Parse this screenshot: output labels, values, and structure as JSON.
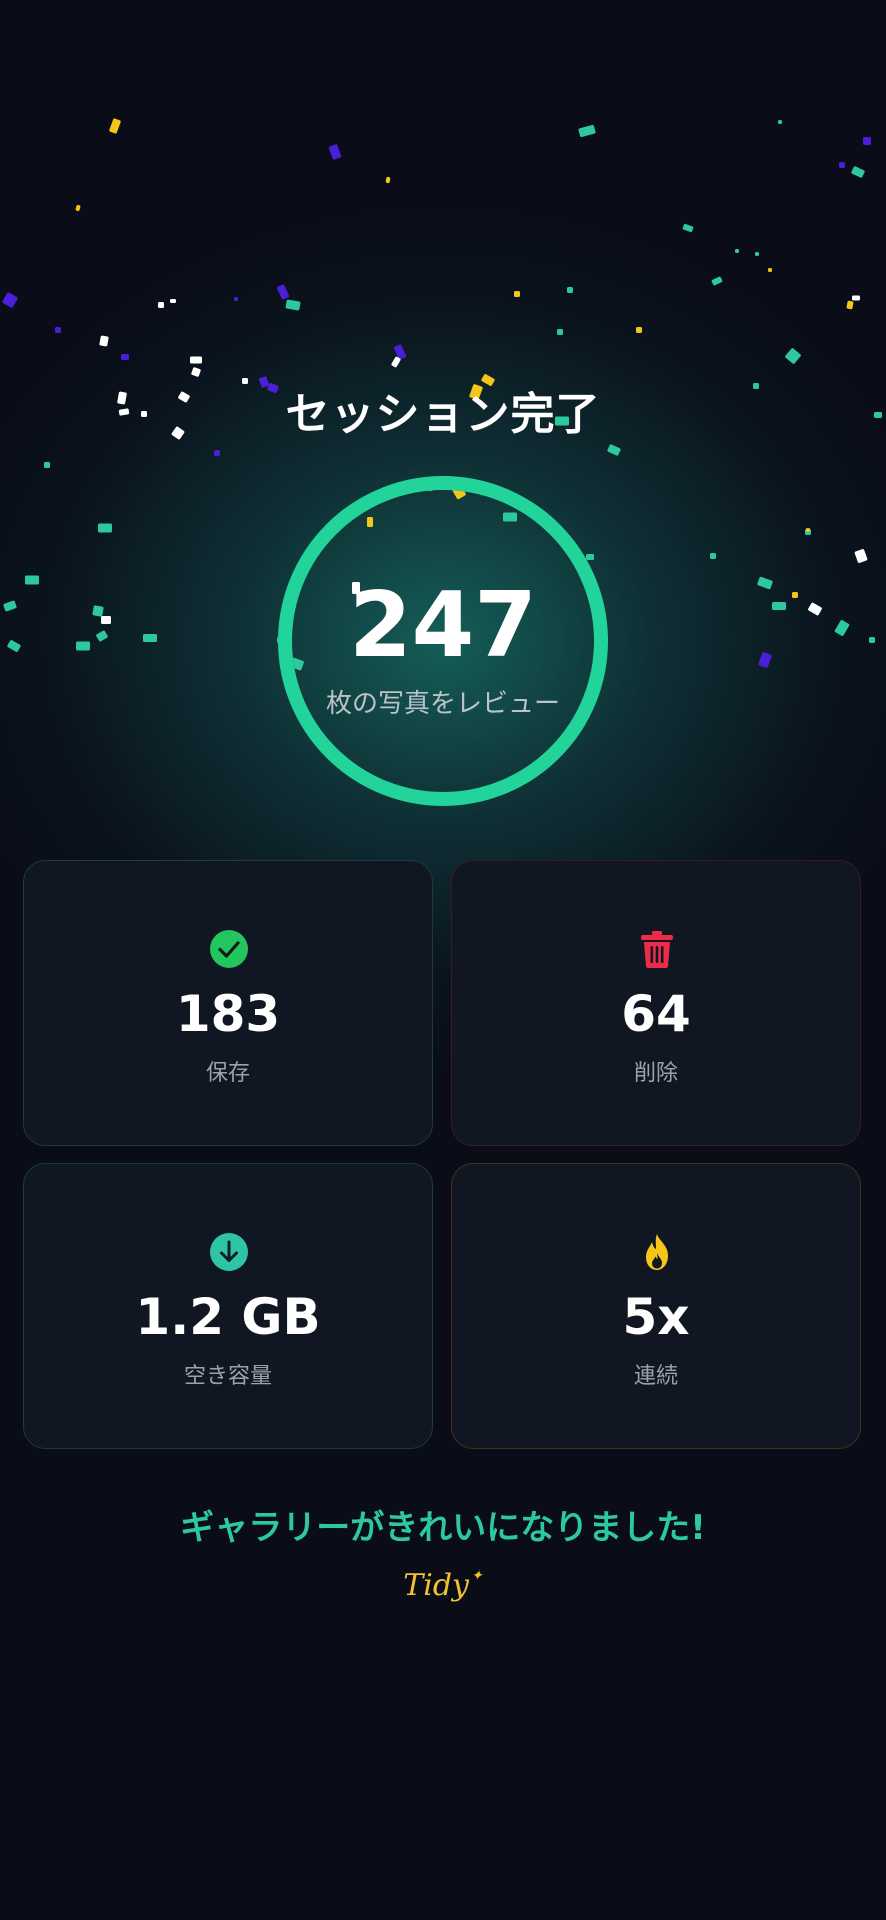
{
  "session": {
    "title": "セッション完了",
    "reviewed_count": "247",
    "reviewed_label": "枚の写真をレビュー",
    "ring_progress": 1.0
  },
  "stats": {
    "keep": {
      "value": "183",
      "label": "保存",
      "icon": "check-circle-icon",
      "color": "#22c55e"
    },
    "delete": {
      "value": "64",
      "label": "削除",
      "icon": "trash-icon",
      "color": "#ef2b4a"
    },
    "space": {
      "value": "1.2 GB",
      "label": "空き容量",
      "icon": "download-circle-icon",
      "color": "#2ec4a6"
    },
    "streak": {
      "value": "5x",
      "label": "連続",
      "icon": "flame-icon",
      "color": "#f5c518"
    }
  },
  "footer": {
    "message": "ギャラリーがきれいになりました!",
    "brand": "Tidy"
  },
  "colors": {
    "background": "#0a0d17",
    "accent": "#2ec8a0",
    "ring": "#22d39a",
    "card": "#111722"
  }
}
